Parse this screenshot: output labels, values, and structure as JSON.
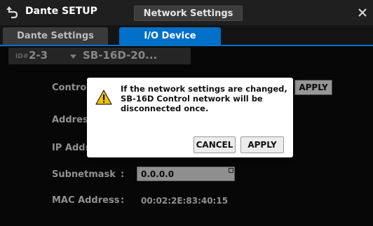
{
  "header": {
    "app_title": "Dante SETUP",
    "page_title": "Network Settings"
  },
  "tabs": [
    {
      "label": "Dante Settings",
      "selected": false
    },
    {
      "label": "I/O Device",
      "selected": true
    }
  ],
  "device": {
    "id_label": "ID#",
    "id_value": "2-3",
    "name": "SB-16D-20..."
  },
  "settings": {
    "control_label": "Control",
    "apply_label": "APPLY",
    "address_label": "Address",
    "ip_label": "IP Addr",
    "subnet_label": "Subnetmask",
    "subnet_colon": ":",
    "subnet_value": "0.0.0.0",
    "mac_label": "MAC Address",
    "mac_colon": ":",
    "mac_value": "00:02:2E:83:40:15"
  },
  "dialog": {
    "message_lines": [
      "If the network settings are changed,",
      "SB-16D Control network will be",
      "disconnected once."
    ],
    "cancel_label": "CANCEL",
    "apply_label": "APPLY"
  },
  "colors": {
    "accent": "#0070c9",
    "warning": "#f2c200"
  },
  "icons": {
    "back": "back-arrow-icon",
    "close": "close-icon",
    "caret": "caret-down-icon",
    "warning": "warning-icon"
  }
}
